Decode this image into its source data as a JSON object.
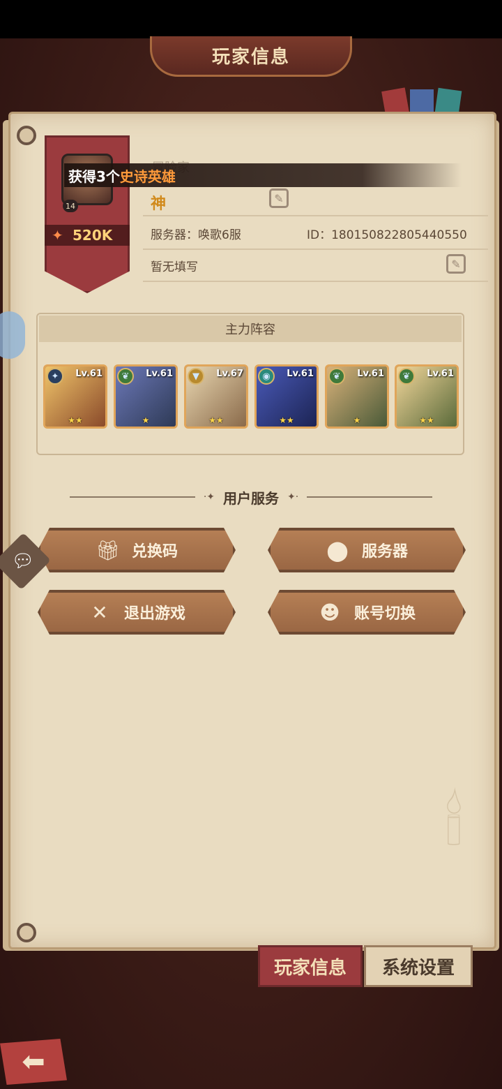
{
  "header": {
    "title": "玩家信息"
  },
  "profile": {
    "avatar_level": "14",
    "power": "520K",
    "rank_label": "冒险家",
    "name": "神",
    "server": "服务器：唤歌6服",
    "id": "ID：180150822805440550",
    "signature": "暂无填写"
  },
  "toast": {
    "prefix": "获得3个",
    "highlight": "史诗英雄"
  },
  "lineup": {
    "title": "主力阵容",
    "heroes": [
      {
        "level": "Lv.61",
        "stars": "★★",
        "faction_icon": "lightbearer-icon",
        "color": "#3b5a92"
      },
      {
        "level": "Lv.61",
        "stars": "★",
        "faction_icon": "wilder-icon",
        "color": "#3f7a3a"
      },
      {
        "level": "Lv.67",
        "stars": "★★",
        "faction_icon": "celestial-icon",
        "color": "#b88a2e"
      },
      {
        "level": "Lv.61",
        "stars": "★★",
        "faction_icon": "graveborn-icon",
        "color": "#2a8a7c"
      },
      {
        "level": "Lv.61",
        "stars": "★",
        "faction_icon": "wilder-icon",
        "color": "#3f7a3a"
      },
      {
        "level": "Lv.61",
        "stars": "★★",
        "faction_icon": "wilder-icon",
        "color": "#3f7a3a"
      }
    ]
  },
  "services": {
    "title": "用户服务",
    "buttons": [
      {
        "label": "兑换码",
        "icon": "gift-icon"
      },
      {
        "label": "服务器",
        "icon": "location-pin-icon"
      },
      {
        "label": "退出游戏",
        "icon": "close-icon"
      },
      {
        "label": "账号切换",
        "icon": "user-icon"
      }
    ]
  },
  "tabs": {
    "player_info": "玩家信息",
    "system_settings": "系统设置"
  },
  "colors": {
    "accent": "#9b3b3e",
    "button": "#a97150",
    "paper": "#e9dcc1",
    "highlight": "#ff9a3a"
  }
}
